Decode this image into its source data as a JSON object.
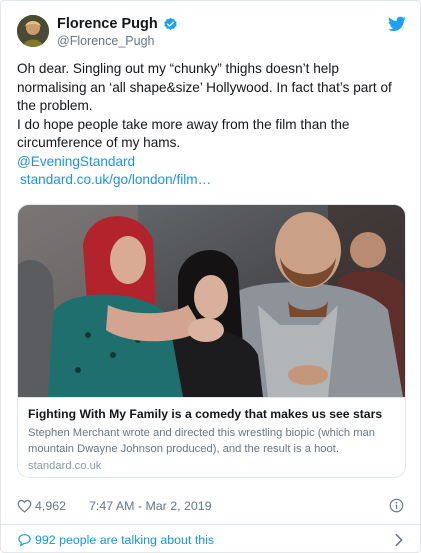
{
  "author": {
    "name": "Florence Pugh",
    "handle": "@Florence_Pugh",
    "verified": true
  },
  "tweet": {
    "line1": "Oh dear. Singling out my “chunky” thighs doesn’t help normalising an ‘all shape&size’ Hollywood. In fact that’s part of the problem.",
    "line2": "I do hope people take more away from the film than the circumference of my hams.",
    "mention": "@EveningStandard",
    "url": "standard.co.uk/go/london/film…"
  },
  "card": {
    "title": "Fighting With My Family is a comedy that makes us see stars",
    "description": "Stephen Merchant wrote and directed this wrestling biopic (which man mountain Dwayne Johnson produced), and the result is a hoot.",
    "domain": "standard.co.uk"
  },
  "meta": {
    "likes": "4,962",
    "timestamp": "7:47 AM - Mar 2, 2019"
  },
  "footer": {
    "talking": "992 people are talking about this"
  },
  "icons": {
    "brand": "twitter-bird",
    "verified": "verified-badge",
    "like": "heart",
    "info": "info-circle",
    "reply": "speech-bubble",
    "more": "chevron-right"
  },
  "colors": {
    "link": "#1b95e0",
    "muted": "#657786",
    "border": "#e1e8ed"
  }
}
